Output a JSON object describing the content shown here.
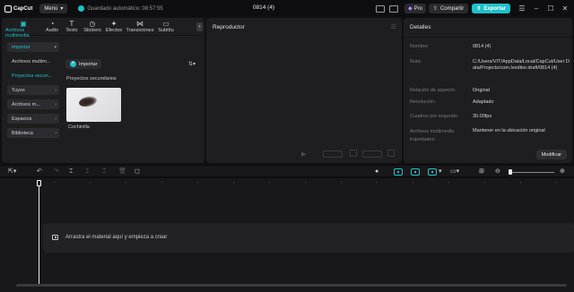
{
  "titlebar": {
    "app_name": "CapCut",
    "menu_label": "Menú",
    "autosave_text": "Guardado automático: 08:57:55",
    "project_title": "0814 (4)",
    "pro_label": "Pro",
    "share_label": "Compartir",
    "export_label": "Exportar",
    "accent_color": "#1fc1c9"
  },
  "media": {
    "tabs": [
      {
        "label": "Archivos multimedia",
        "icon": "media-icon"
      },
      {
        "label": "Audio",
        "icon": "audio-icon"
      },
      {
        "label": "Texto",
        "icon": "text-icon"
      },
      {
        "label": "Stickers",
        "icon": "sticker-icon"
      },
      {
        "label": "Efectos",
        "icon": "effects-icon"
      },
      {
        "label": "Transiciones",
        "icon": "transitions-icon"
      },
      {
        "label": "Subtítu",
        "icon": "subtitles-icon"
      }
    ],
    "sidebar": [
      {
        "label": "Importar"
      },
      {
        "label": "Archivos multim..."
      },
      {
        "label": "Proyectos secun..."
      },
      {
        "label": "Tuyos"
      },
      {
        "label": "Archivos m..."
      },
      {
        "label": "Espacios"
      },
      {
        "label": "Biblioteca"
      }
    ],
    "import_button": "Importar",
    "section_title": "Proyectos secundarios",
    "clip_name": "Cochinilla"
  },
  "player": {
    "title": "Reproductor"
  },
  "details": {
    "title": "Detalles",
    "rows": [
      {
        "key": "Nombre:",
        "value": "0814 (4)"
      },
      {
        "key": "Ruta:",
        "value": "C:/Users/VIT/AppData/Local/CapCut/User Data/Projects/com.lveditor.draft/0814 (4)"
      },
      {
        "key": "Relación de aspecto:",
        "value": "Original"
      },
      {
        "key": "Resolución:",
        "value": "Adaptado"
      },
      {
        "key": "Cuadros por segundo:",
        "value": "30.00fps"
      },
      {
        "key": "Archivos multimedia importados:",
        "value": "Mantener en la ubicación original"
      }
    ],
    "modify_button": "Modificar"
  },
  "timeline": {
    "hint": "Arrastra el material aquí y empieza a crear"
  }
}
